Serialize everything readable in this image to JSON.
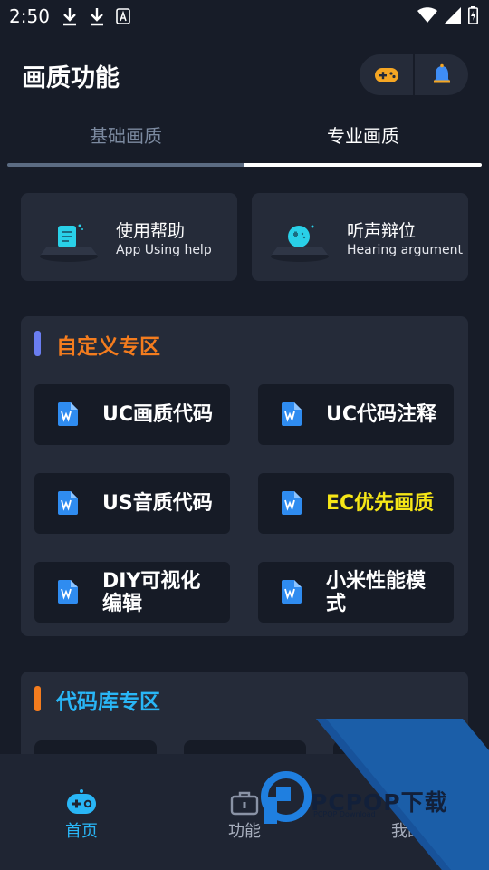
{
  "status_bar": {
    "time": "2:50"
  },
  "header": {
    "title": "画质功能"
  },
  "tabs": [
    {
      "label": "基础画质"
    },
    {
      "label": "专业画质"
    }
  ],
  "help_cards": [
    {
      "title": "使用帮助",
      "subtitle": "App Using help"
    },
    {
      "title": "听声辩位",
      "subtitle": "Hearing argument"
    }
  ],
  "sections": [
    {
      "title": "自定义专区",
      "accent": "#f47c1e",
      "bar_color": "#6a7df0",
      "tiles": [
        {
          "label": "UC画质代码",
          "color": "#ffffff"
        },
        {
          "label": "UC代码注释",
          "color": "#ffffff"
        },
        {
          "label": "US音质代码",
          "color": "#ffffff"
        },
        {
          "label": "EC优先画质",
          "color": "#f5e617"
        },
        {
          "label": "DIY可视化编辑",
          "color": "#ffffff"
        },
        {
          "label": "小米性能模式",
          "color": "#ffffff"
        }
      ]
    },
    {
      "title": "代码库专区",
      "accent": "#29b6f6",
      "bar_color": "#f47c1e"
    }
  ],
  "bottom_nav": [
    {
      "label": "首页",
      "icon": "gamepad-icon",
      "active": true
    },
    {
      "label": "功能",
      "icon": "briefcase-icon",
      "active": false
    },
    {
      "label": "我的",
      "icon": "user-icon",
      "active": false
    }
  ],
  "watermark": {
    "text": "PCPOP下载",
    "subtext": "PCPOP Download"
  },
  "colors": {
    "background": "#171c28",
    "card": "#252b39",
    "tile": "#161b26",
    "active_nav": "#29b6f6"
  }
}
